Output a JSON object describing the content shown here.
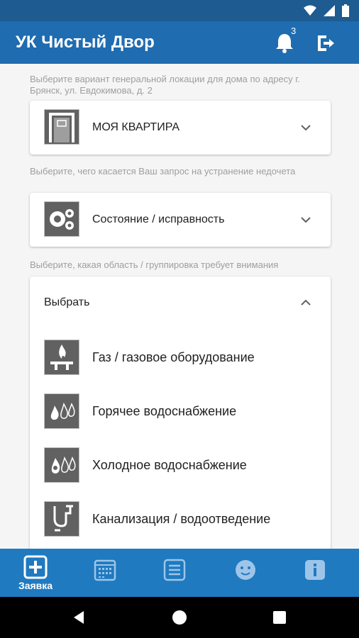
{
  "app": {
    "title": "УК Чистый Двор",
    "notification_count": "3"
  },
  "location": {
    "hint": "Выберите вариант генеральной локации для дома по адресу г. Брянск, ул. Евдокимова, д. 2",
    "selected": "МОЯ КВАРТИРА"
  },
  "request_type": {
    "hint": "Выберите, чего касается Ваш запрос на устранение недочета",
    "selected": "Состояние / исправность"
  },
  "area": {
    "hint": "Выберите, какая область / группировка требует внимания",
    "placeholder": "Выбрать",
    "options": [
      {
        "label": "Газ / газовое оборудование",
        "icon": "gas-burner-icon"
      },
      {
        "label": "Горячее водоснабжение",
        "icon": "hot-water-icon"
      },
      {
        "label": "Холодное водоснабжение",
        "icon": "cold-water-icon"
      },
      {
        "label": "Канализация / водоотведение",
        "icon": "sewerage-icon"
      }
    ]
  },
  "bottom_nav": {
    "items": [
      {
        "label": "Заявка",
        "icon": "add-request-icon",
        "active": true
      },
      {
        "label": "",
        "icon": "calendar-icon",
        "active": false
      },
      {
        "label": "",
        "icon": "list-icon",
        "active": false
      },
      {
        "label": "",
        "icon": "face-icon",
        "active": false
      },
      {
        "label": "",
        "icon": "info-icon",
        "active": false
      }
    ]
  },
  "colors": {
    "app_bar": "#1f6cb0",
    "status_bar": "#1d5b91",
    "bottom_nav": "#1f7ac0",
    "tile": "#616161"
  }
}
